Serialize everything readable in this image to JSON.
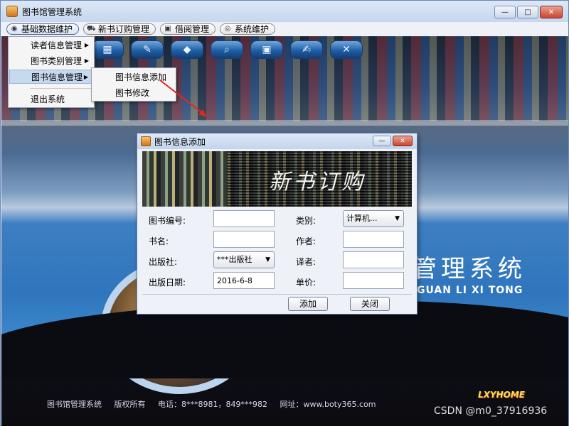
{
  "window": {
    "title": "图书馆管理系统",
    "minimize": "—",
    "maximize": "□",
    "close": "✕"
  },
  "menubar": {
    "items": [
      {
        "label": "基础数据维护",
        "icon": "box-icon"
      },
      {
        "label": "新书订购管理",
        "icon": "cart-icon"
      },
      {
        "label": "借阅管理",
        "icon": "lock-icon"
      },
      {
        "label": "系统维护",
        "icon": "cd-icon"
      }
    ]
  },
  "dropdown": {
    "items": [
      {
        "label": "读者信息管理",
        "arrow": "▶"
      },
      {
        "label": "图书类别管理",
        "arrow": "▶"
      },
      {
        "label": "图书信息管理",
        "arrow": "▶"
      },
      {
        "label": "退出系统",
        "arrow": ""
      }
    ],
    "submenu": [
      "图书信息添加",
      "图书修改"
    ]
  },
  "toolbar": [
    "▦",
    "✎",
    "◆",
    "⌕",
    "▣",
    "✍",
    "✕"
  ],
  "background": {
    "title": "管理系统",
    "subtitle": "GUAN LI XI TONG",
    "footer": {
      "system": "图书馆管理系统",
      "rights": "版权所有",
      "phone": "电话：8***8981，849***982",
      "site": "网址：www.boty365.com"
    },
    "logo": "LXYHOME",
    "watermark": "CSDN @m0_37916936"
  },
  "dialog": {
    "title": "图书信息添加",
    "banner": "新书订购",
    "fields": {
      "book_id": {
        "label": "图书编号:",
        "value": ""
      },
      "category": {
        "label": "类别:",
        "value": "计算机..."
      },
      "name": {
        "label": "书名:",
        "value": ""
      },
      "author": {
        "label": "作者:",
        "value": ""
      },
      "publisher": {
        "label": "出版社:",
        "value": "***出版社"
      },
      "translator": {
        "label": "译者:",
        "value": ""
      },
      "date": {
        "label": "出版日期:",
        "value": "2016-6-8"
      },
      "price": {
        "label": "单价:",
        "value": ""
      }
    },
    "add_button": "添加",
    "close_button": "关闭"
  },
  "colors": {
    "accent": "#2f75bd",
    "arrow": "#e0281e",
    "background_dark": "#0b0c12"
  }
}
